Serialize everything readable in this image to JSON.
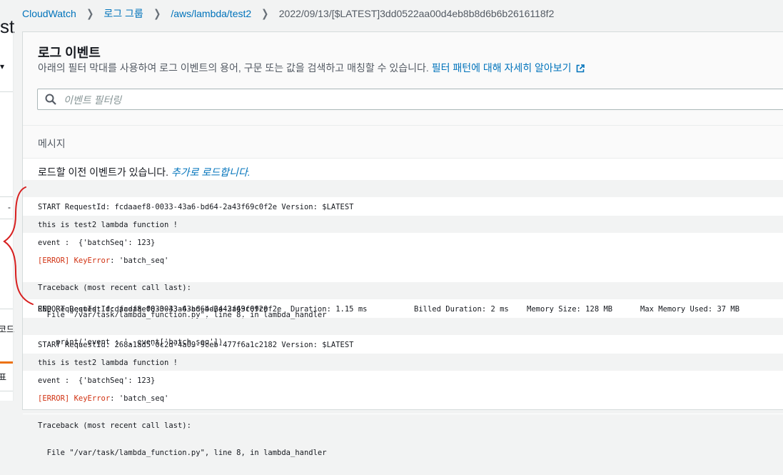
{
  "breadcrumb": {
    "items": [
      {
        "label": "CloudWatch"
      },
      {
        "label": "로그 그룹"
      },
      {
        "label": "/aws/lambda/test2"
      }
    ],
    "current": "2022/09/13/[$LATEST]3dd0522aa00d4eb8b8d6b6b2616118f2"
  },
  "sidebar": {
    "title_fragment": "st",
    "frag_dash": "-",
    "frag_code": "코드",
    "frag_pyo": "표"
  },
  "panel": {
    "title": "로그 이벤트",
    "description": "아래의 필터 막대를 사용하여 로그 이벤트의 용어, 구문 또는 값을 검색하고 매칭할 수 있습니다.",
    "learn_more": "필터 패턴에 대해 자세히 알아보기"
  },
  "search": {
    "placeholder": "이벤트 필터링",
    "value": ""
  },
  "table": {
    "column_message": "메시지",
    "older_text": "로드할 이전 이벤트가 있습니다.",
    "older_link": "추가로 로드합니다."
  },
  "events": {
    "e1": "START RequestId: fcdaaef8-0033-43a6-bd64-2a43f69c0f2e Version: $LATEST",
    "e2": "this is test2 lambda function !",
    "e3": "event :  {'batchSeq': 123}",
    "e4_err": "[ERROR]",
    "e4_kerr": "KeyError",
    "e4_rest": ": 'batch_seq'",
    "e4_l2": "Traceback (most recent call last):",
    "e4_l3": "  File \"/var/task/lambda_function.py\", line 8, in lambda_handler",
    "e4_l4": "    print('event : ', event['batch_seq'])",
    "e5": "END RequestId: fcdaaef8-0033-43a6-bd64-2a43f69c0f2e",
    "e6_a": "REPORT RequestId: fcdaaef8-0033-43a6-bd64-2a43f69c0f2e  Duration: 1.15 ms",
    "e6_b": "Billed Duration: 2 ms",
    "e6_c": "Memory Size: 128 MB",
    "e6_d": "Max Memory Used: 37 MB",
    "e7": "START RequestId: 268a1ad5-0c2d-4a09-9ceb-477f6a1c2182 Version: $LATEST",
    "e8": "this is test2 lambda function !",
    "e9": "event :  {'batchSeq': 123}",
    "e10_err": "[ERROR]",
    "e10_kerr": "KeyError",
    "e10_rest": ": 'batch_seq'",
    "e10_l2": "Traceback (most recent call last):",
    "e10_l3": "  File \"/var/task/lambda_function.py\", line 8, in lambda_handler"
  }
}
